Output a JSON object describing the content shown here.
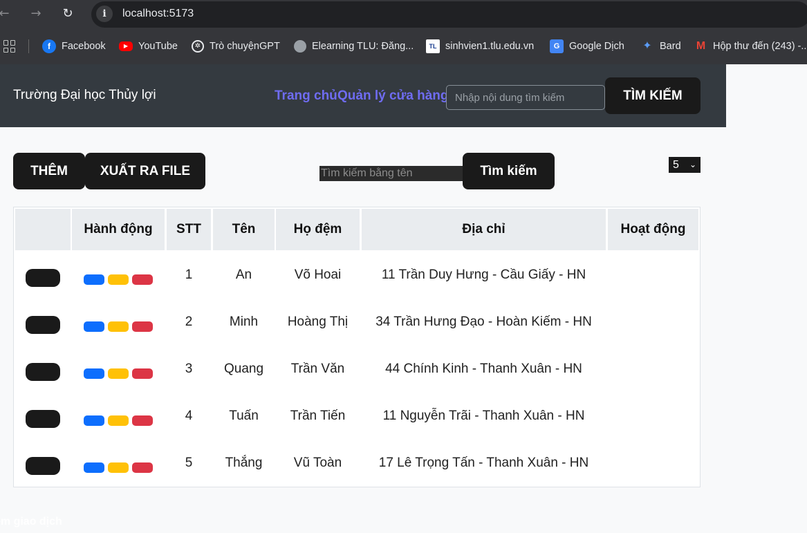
{
  "browser": {
    "url": "localhost:5173",
    "bookmarks": [
      {
        "label": "Facebook",
        "icon": "facebook-icon"
      },
      {
        "label": "YouTube",
        "icon": "youtube-icon"
      },
      {
        "label": "Trò chuyệnGPT",
        "icon": "chatgpt-icon"
      },
      {
        "label": "Elearning TLU: Đăng...",
        "icon": "globe-icon"
      },
      {
        "label": "sinhvien1.tlu.edu.vn",
        "icon": "tlu-icon"
      },
      {
        "label": "Google Dịch",
        "icon": "google-translate-icon"
      },
      {
        "label": "Bard",
        "icon": "bard-icon"
      },
      {
        "label": "Hộp thư đến (243) -...",
        "icon": "gmail-icon"
      }
    ]
  },
  "header": {
    "brand": "Trường Đại học Thủy lợi",
    "nav_home": "Trang chủ",
    "nav_store": "Quản lý cửa hàng",
    "search_placeholder": "Nhập nội dung tìm kiếm",
    "search_button": "TÌM KIẾM"
  },
  "toolbar": {
    "add_button": "THÊM",
    "export_button": "XUẤT RA FILE",
    "name_search_placeholder": "Tìm kiếm bằng tên",
    "search_button": "Tìm kiếm",
    "page_size": "5"
  },
  "table": {
    "columns": [
      "",
      "Hành động",
      "STT",
      "Tên",
      "Họ đệm",
      "Địa chỉ",
      "Hoạt động"
    ],
    "rows": [
      {
        "stt": "1",
        "ten": "An",
        "ho_dem": "Võ Hoai",
        "dia_chi": "11 Trần Duy Hưng - Cầu Giấy - HN"
      },
      {
        "stt": "2",
        "ten": "Minh",
        "ho_dem": "Hoàng Thị",
        "dia_chi": "34 Trần Hưng Đạo - Hoàn Kiếm - HN"
      },
      {
        "stt": "3",
        "ten": "Quang",
        "ho_dem": "Trần Văn",
        "dia_chi": "44 Chính Kinh - Thanh Xuân - HN"
      },
      {
        "stt": "4",
        "ten": "Tuấn",
        "ho_dem": "Trần Tiến",
        "dia_chi": "11 Nguyễn Trãi - Thanh Xuân - HN"
      },
      {
        "stt": "5",
        "ten": "Thắng",
        "ho_dem": "Vũ Toàn",
        "dia_chi": "17 Lê Trọng Tấn - Thanh Xuân - HN"
      }
    ]
  },
  "footer": {
    "text": "êm giao dịch"
  },
  "colors": {
    "nav_link": "#6f6cf2",
    "header_bg": "#343a40",
    "button_dark": "#1a1a1a",
    "edit_blue": "#0d6efd",
    "warn_yellow": "#ffc107",
    "delete_red": "#dc3545"
  }
}
